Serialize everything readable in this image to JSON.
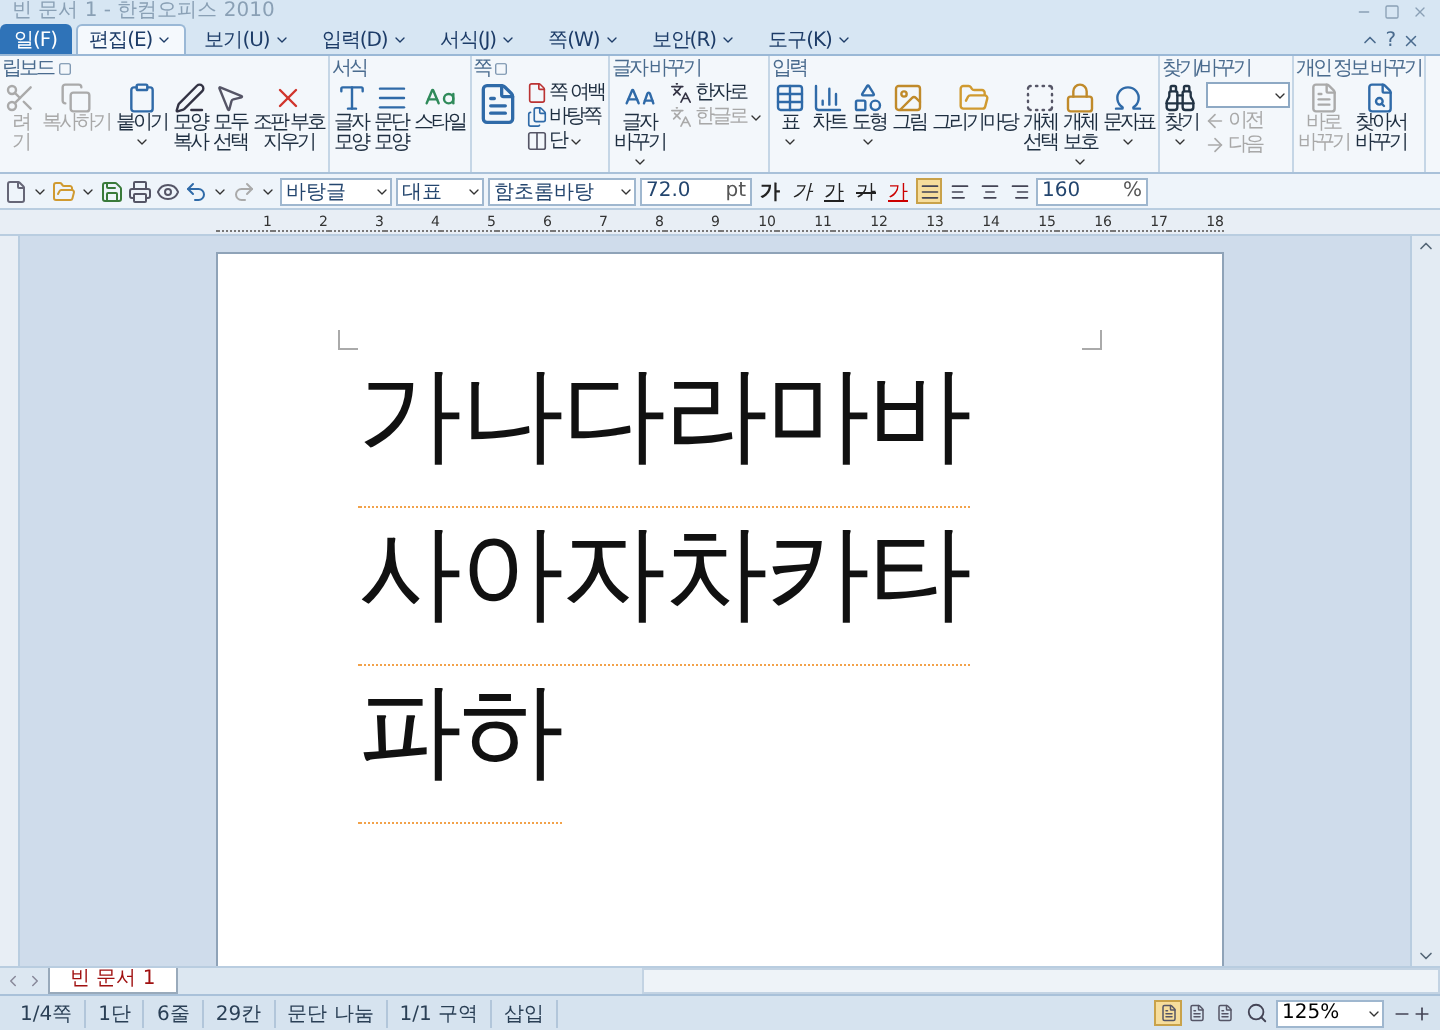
{
  "window": {
    "title": "빈 문서 1 - 한컴오피스 2010"
  },
  "menu": [
    {
      "label": "일(F)",
      "kind": "file",
      "selected": false
    },
    {
      "label": "편집(E)",
      "kind": "tab",
      "selected": true
    },
    {
      "label": "보기(U)",
      "kind": "tab",
      "selected": false
    },
    {
      "label": "입력(D)",
      "kind": "tab",
      "selected": false
    },
    {
      "label": "서식(J)",
      "kind": "tab",
      "selected": false
    },
    {
      "label": "쪽(W)",
      "kind": "tab",
      "selected": false
    },
    {
      "label": "보안(R)",
      "kind": "tab",
      "selected": false
    },
    {
      "label": "도구(K)",
      "kind": "tab",
      "selected": false
    }
  ],
  "ribbon": {
    "help": "?",
    "groups": [
      {
        "title": "립보드",
        "launcher": true,
        "items": [
          {
            "kind": "large",
            "label": "려\n기",
            "disabled": true,
            "dropdown": false
          },
          {
            "kind": "large",
            "label": "복사하기",
            "disabled": true,
            "dropdown": false
          },
          {
            "kind": "large",
            "label": "붙이기",
            "disabled": false,
            "dropdown": true
          },
          {
            "kind": "large",
            "label": "모양\n복사",
            "disabled": false,
            "dropdown": false
          },
          {
            "kind": "large",
            "label": "모두\n선택",
            "disabled": false,
            "dropdown": false
          },
          {
            "kind": "large",
            "label": "조판 부호\n지우기",
            "disabled": false,
            "dropdown": false
          }
        ]
      },
      {
        "title": "서식",
        "launcher": false,
        "items": [
          {
            "kind": "large",
            "label": "글자\n모양",
            "disabled": false,
            "dropdown": false
          },
          {
            "kind": "large",
            "label": "문단\n모양",
            "disabled": false,
            "dropdown": false
          },
          {
            "kind": "large",
            "label": "스타일",
            "disabled": false,
            "dropdown": false
          }
        ]
      },
      {
        "title": "쪽",
        "launcher": true,
        "items": [
          {
            "kind": "large",
            "disabled": false,
            "dropdown": false
          },
          {
            "kind": "small",
            "label": "쪽 여백",
            "disabled": false,
            "dropdown": false
          },
          {
            "kind": "small",
            "label": "바탕쪽",
            "disabled": false,
            "dropdown": false
          },
          {
            "kind": "small",
            "label": "단",
            "disabled": false,
            "dropdown": true
          }
        ]
      },
      {
        "title": "글자 바꾸기",
        "launcher": false,
        "items": [
          {
            "kind": "large",
            "label": "글자\n바꾸기",
            "disabled": false,
            "dropdown": true
          },
          {
            "kind": "small",
            "label": "한자로",
            "disabled": false,
            "dropdown": false
          },
          {
            "kind": "small",
            "label": "한글로",
            "disabled": true,
            "dropdown": true
          }
        ]
      },
      {
        "title": "입력",
        "launcher": false,
        "items": [
          {
            "kind": "large",
            "label": "표",
            "disabled": false,
            "dropdown": true
          },
          {
            "kind": "large",
            "label": "차트",
            "disabled": false,
            "dropdown": false
          },
          {
            "kind": "large",
            "label": "도형",
            "disabled": false,
            "dropdown": true
          },
          {
            "kind": "large",
            "label": "그림",
            "disabled": false,
            "dropdown": false
          },
          {
            "kind": "large",
            "label": "그리기마당",
            "disabled": false,
            "dropdown": false
          },
          {
            "kind": "large",
            "label": "개체\n선택",
            "disabled": false,
            "dropdown": false
          },
          {
            "kind": "large",
            "label": "개체\n보호",
            "disabled": false,
            "dropdown": true
          },
          {
            "kind": "large",
            "label": "문자표",
            "disabled": false,
            "dropdown": true
          }
        ]
      },
      {
        "title": "찾기/바꾸기",
        "launcher": false,
        "items": [
          {
            "kind": "large",
            "label": "찾기",
            "disabled": false,
            "dropdown": true
          },
          {
            "kind": "field",
            "dropdown": true
          },
          {
            "kind": "small",
            "label": "이전",
            "disabled": true,
            "dropdown": false
          },
          {
            "kind": "small",
            "label": "다음",
            "disabled": true,
            "dropdown": false
          }
        ]
      },
      {
        "title": "개인 정보 바꾸기",
        "launcher": false,
        "items": [
          {
            "kind": "large",
            "label": "바로\n바꾸기",
            "disabled": true,
            "dropdown": false
          },
          {
            "kind": "large",
            "label": "찾아서\n바꾸기",
            "disabled": false,
            "dropdown": false
          }
        ]
      }
    ]
  },
  "toolbar": {
    "style": "바탕글",
    "language": "대표",
    "font": "함초롬바탕",
    "size": "72.0",
    "unit": "pt",
    "format": [
      {
        "label": "가",
        "kind": "bold"
      },
      {
        "label": "가",
        "kind": "italic"
      },
      {
        "label": "가",
        "kind": "underline"
      },
      {
        "label": "가",
        "kind": "strike"
      },
      {
        "label": "가",
        "kind": "color"
      }
    ],
    "align": [
      {
        "selected": true
      },
      {
        "selected": false
      },
      {
        "selected": false
      },
      {
        "selected": false
      }
    ],
    "spacing": "160",
    "spacing_unit": "%"
  },
  "ruler": [
    "1",
    "2",
    "3",
    "4",
    "5",
    "6",
    "7",
    "8",
    "9",
    "10",
    "11",
    "12",
    "13",
    "14",
    "15",
    "16",
    "17",
    "18"
  ],
  "document": {
    "lines": [
      "가나다라마바",
      "사아자차카타",
      "파하"
    ]
  },
  "tab": {
    "label": "빈 문서 1",
    "selected": true
  },
  "status_bar": {
    "items": [
      "1/4쪽",
      "1단",
      "6줄",
      "29칸",
      "문단 나눔",
      "1/1 구역",
      "삽입"
    ],
    "views": [
      {
        "selected": true
      },
      {
        "selected": false
      },
      {
        "selected": false
      }
    ],
    "zoom": "125%"
  }
}
